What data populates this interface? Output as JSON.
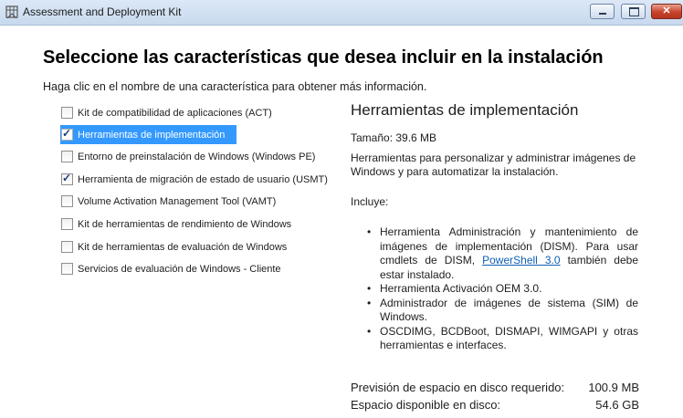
{
  "window": {
    "title": "Assessment and Deployment Kit",
    "buttons": {
      "minimize": "minimize-icon",
      "maximize": "maximize-icon",
      "close": "close-icon",
      "close_glyph": "✕"
    }
  },
  "heading": "Seleccione las características que desea incluir en la instalación",
  "instruction": "Haga clic en el nombre de una característica para obtener más información.",
  "features": [
    {
      "label": "Kit de compatibilidad de aplicaciones (ACT)",
      "checked": false,
      "selected": false
    },
    {
      "label": "Herramientas de implementación",
      "checked": true,
      "selected": true
    },
    {
      "label": "Entorno de preinstalación de Windows (Windows PE)",
      "checked": false,
      "selected": false
    },
    {
      "label": "Herramienta de migración de estado de usuario (USMT)",
      "checked": true,
      "selected": false
    },
    {
      "label": "Volume Activation Management Tool (VAMT)",
      "checked": false,
      "selected": false
    },
    {
      "label": "Kit de herramientas de rendimiento de Windows",
      "checked": false,
      "selected": false
    },
    {
      "label": "Kit de herramientas de evaluación de Windows",
      "checked": false,
      "selected": false
    },
    {
      "label": "Servicios de evaluación de Windows - Cliente",
      "checked": false,
      "selected": false
    }
  ],
  "detail": {
    "title": "Herramientas de implementación",
    "size": "Tamaño: 39.6 MB",
    "description": "Herramientas para personalizar y administrar imágenes de Windows y para automatizar la instalación.",
    "includes_label": "Incluye:",
    "bullet1_pre": "Herramienta Administración y mantenimiento de imágenes de implementación (DISM). Para usar cmdlets de DISM, ",
    "bullet1_link": "PowerShell 3.0",
    "bullet1_post": " también debe estar instalado.",
    "bullet2": "Herramienta Activación OEM 3.0.",
    "bullet3": "Administrador de imágenes de sistema (SIM) de Windows.",
    "bullet4": "OSCDIMG, BCDBoot, DISMAPI, WIMGAPI y otras herramientas e interfaces."
  },
  "space": {
    "required_label": "Previsión de espacio en disco requerido:",
    "required_value": "100.9 MB",
    "available_label": "Espacio disponible en disco:",
    "available_value": "54.6 GB"
  },
  "colors": {
    "selection": "#3399ff",
    "link": "#0f5fb6"
  }
}
